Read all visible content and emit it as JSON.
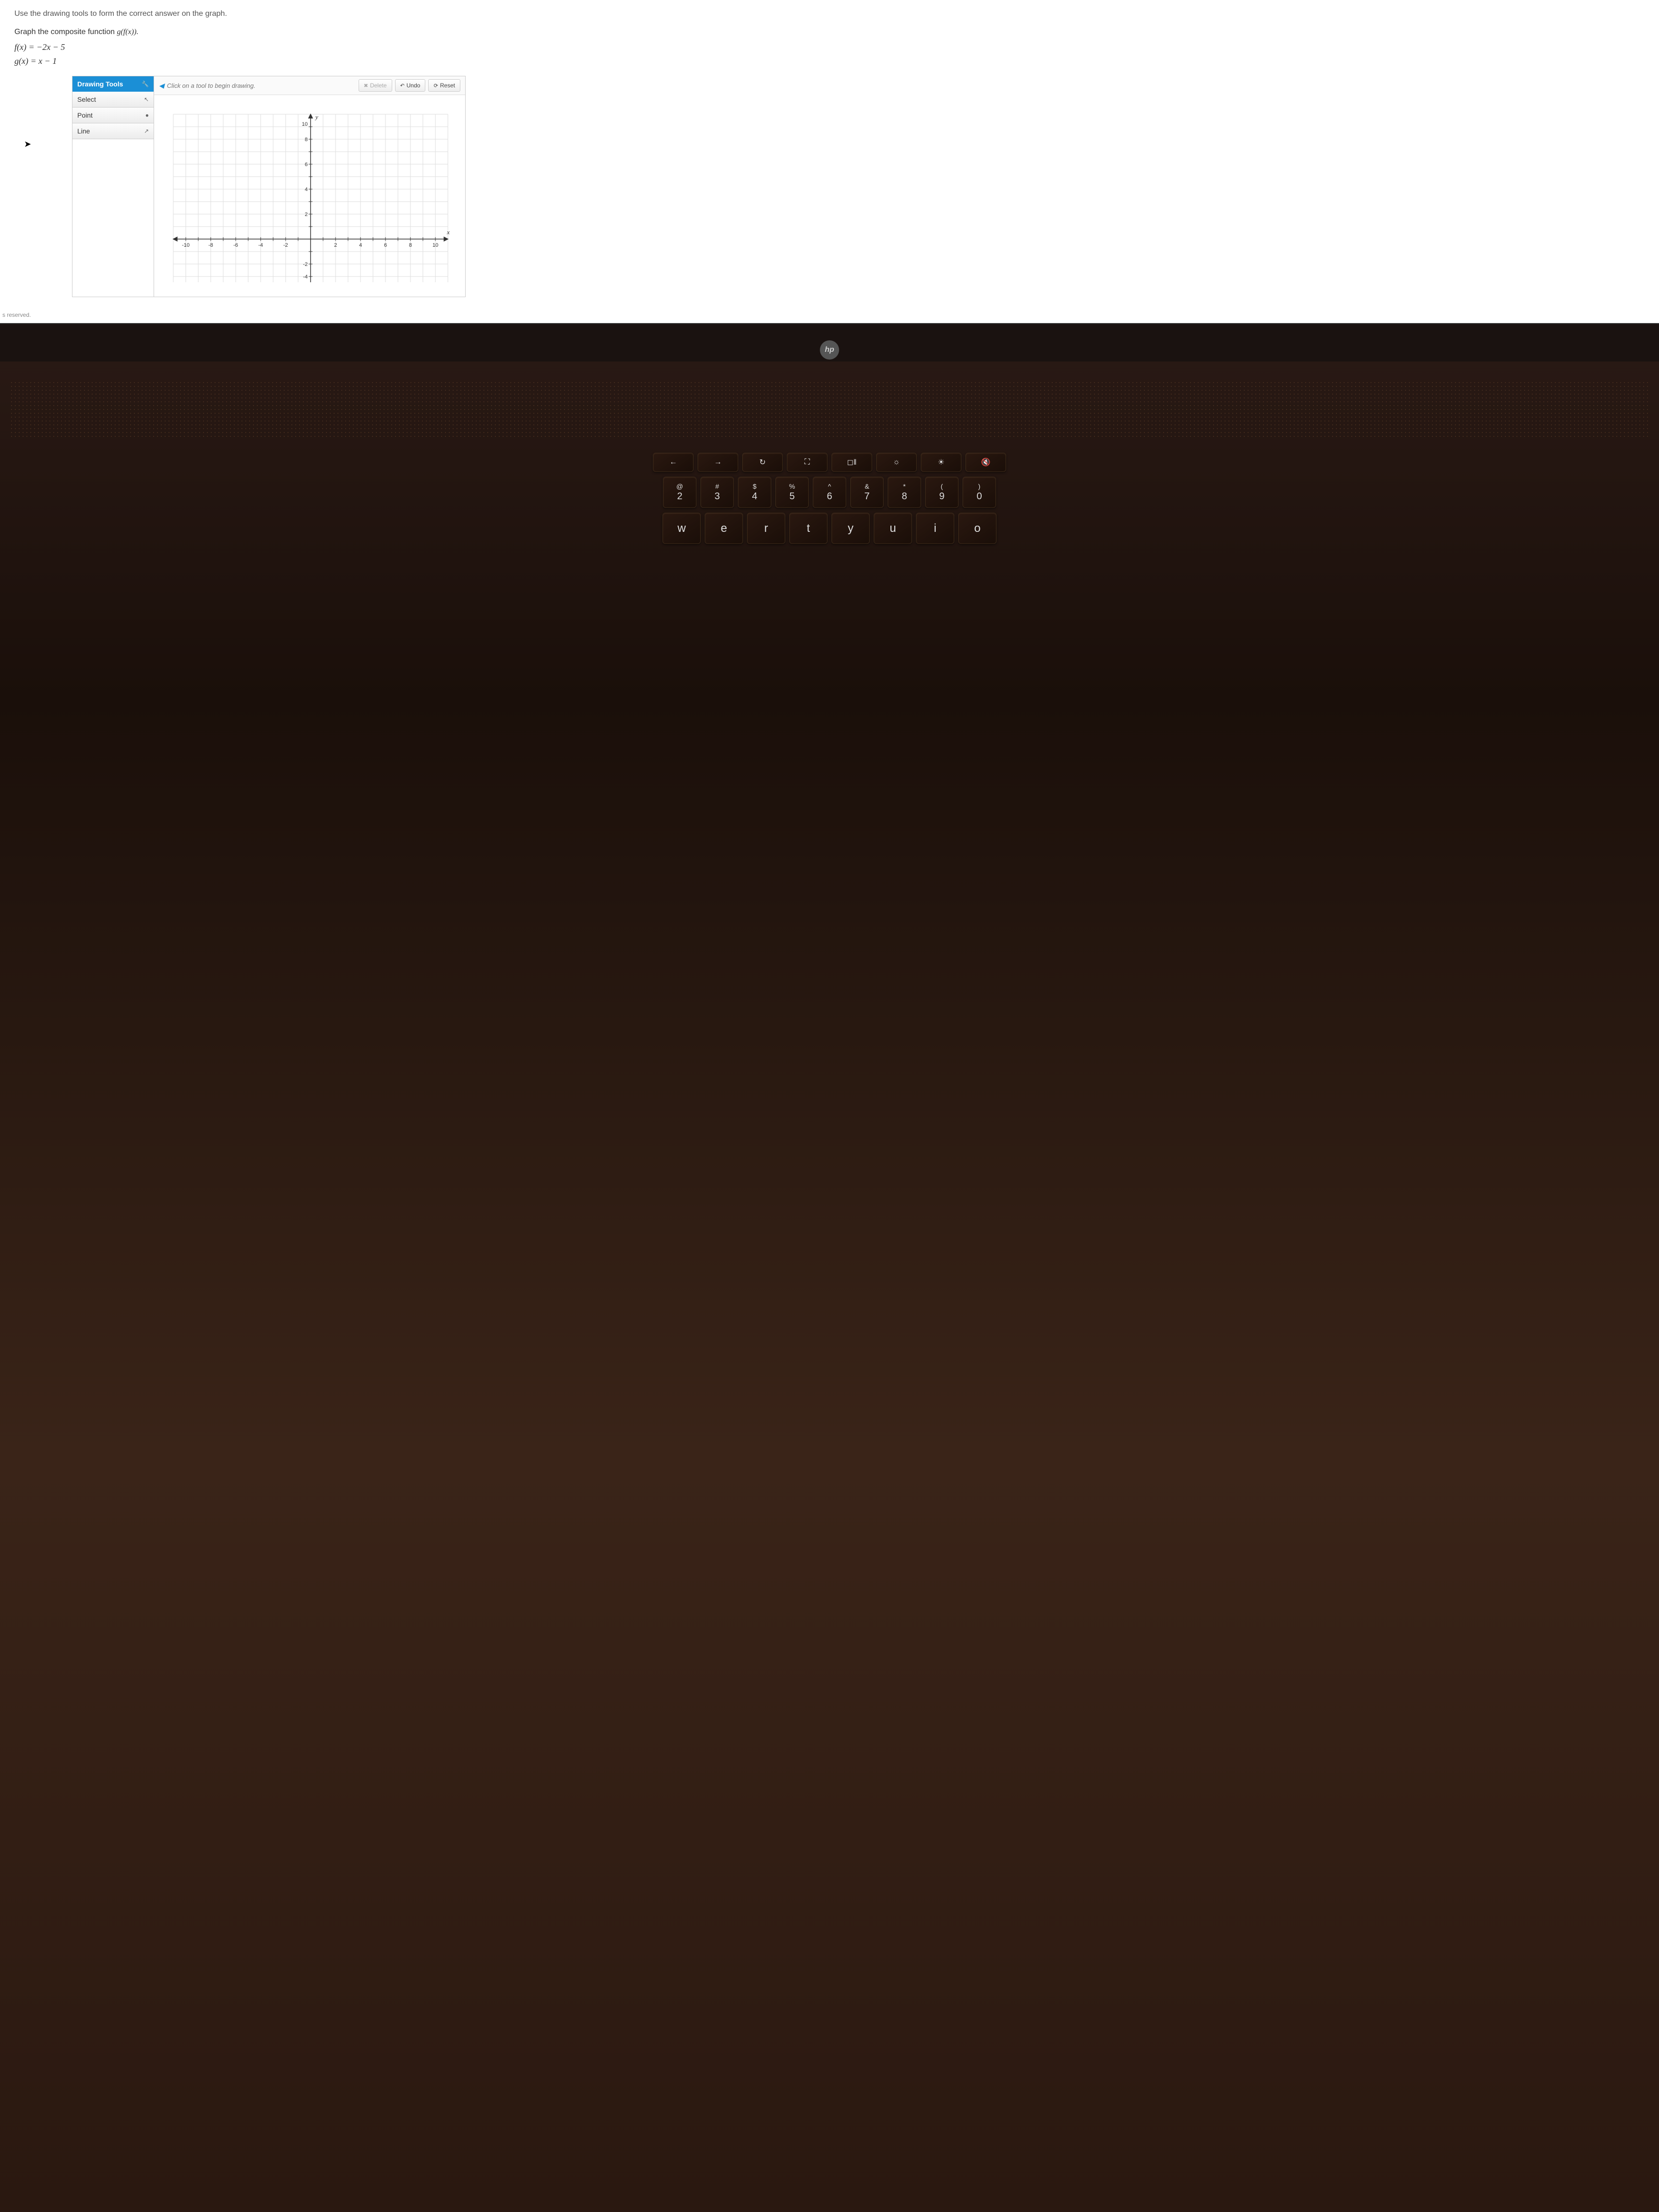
{
  "instruction": "Use the drawing tools to form the correct answer on the graph.",
  "question_prefix": "Graph the composite function ",
  "question_math": "g(f(x)).",
  "equation1": "f(x) = −2x − 5",
  "equation2": "g(x) = x − 1",
  "tools": {
    "header": "Drawing Tools",
    "items": [
      "Select",
      "Point",
      "Line"
    ]
  },
  "toolbar": {
    "hint": "Click on a tool to begin drawing.",
    "delete": "Delete",
    "undo": "Undo",
    "reset": "Reset"
  },
  "axes": {
    "x_label": "x",
    "y_label": "y",
    "x_ticks": [
      -10,
      -8,
      -6,
      -4,
      -2,
      2,
      4,
      6,
      8,
      10
    ],
    "y_ticks": [
      -4,
      -2,
      2,
      4,
      6,
      8,
      10
    ]
  },
  "footer": "s reserved.",
  "hp_logo": "hp",
  "keyboard": {
    "fn_row": [
      "←",
      "→",
      "↻",
      "⛶",
      "◻‖",
      "☼",
      "☀",
      "🔇"
    ],
    "num_row": [
      {
        "s": "@",
        "n": "2"
      },
      {
        "s": "#",
        "n": "3"
      },
      {
        "s": "$",
        "n": "4"
      },
      {
        "s": "%",
        "n": "5"
      },
      {
        "s": "^",
        "n": "6"
      },
      {
        "s": "&",
        "n": "7"
      },
      {
        "s": "*",
        "n": "8"
      },
      {
        "s": "(",
        "n": "9"
      },
      {
        "s": ")",
        "n": "0"
      }
    ],
    "letter_row": [
      "w",
      "e",
      "r",
      "t",
      "y",
      "u",
      "i",
      "o"
    ]
  }
}
